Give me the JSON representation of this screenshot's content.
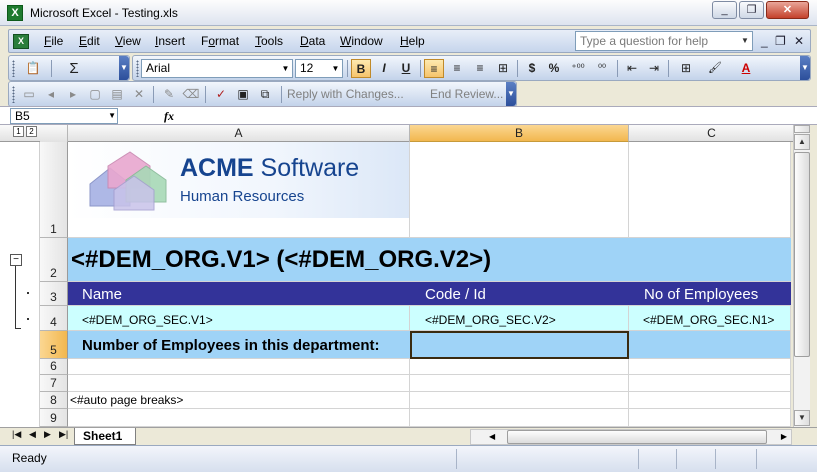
{
  "window": {
    "title": "Microsoft Excel - Testing.xls",
    "app_icon": "X",
    "minimize": "_",
    "restore": "❐",
    "close": "✕"
  },
  "menu": {
    "doc_icon": "X",
    "items": [
      {
        "u": "F",
        "rest": "ile"
      },
      {
        "u": "E",
        "rest": "dit"
      },
      {
        "u": "V",
        "rest": "iew"
      },
      {
        "u": "I",
        "rest": "nsert"
      },
      {
        "pre": "F",
        "u": "o",
        "rest": "rmat"
      },
      {
        "u": "T",
        "rest": "ools"
      },
      {
        "u": "D",
        "rest": "ata"
      },
      {
        "u": "W",
        "rest": "indow"
      },
      {
        "u": "H",
        "rest": "elp"
      }
    ],
    "help_placeholder": "Type a question for help",
    "doc_min": "_",
    "doc_restore": "❐",
    "doc_close": "✕"
  },
  "toolbar1": {
    "paste_icon": "📋",
    "autosum": "Σ",
    "font": "Arial",
    "size": "12",
    "bold": "B",
    "italic": "I",
    "underline": "U",
    "align_left": "≡",
    "center": "≡",
    "align_right": "≡",
    "merge": "⊞",
    "currency": "$",
    "percent": "%",
    "inc_dec": "⁺⁰⁰",
    "dec_dec": "⁰⁰",
    "outdent": "⇤",
    "indent": "⇥",
    "borders": "⊞",
    "fill": "🖌",
    "font_color": "A"
  },
  "toolbar2": {
    "reply": "Reply with Changes...",
    "end_review": "End Review..."
  },
  "formula_bar": {
    "name_box": "B5",
    "fx": "fx",
    "formula": ""
  },
  "columns": [
    "A",
    "B",
    "C"
  ],
  "level_buttons": [
    "1",
    "2"
  ],
  "rows": [
    "1",
    "2",
    "3",
    "4",
    "5",
    "6",
    "7",
    "8",
    "9"
  ],
  "outline_collapse": "−",
  "logo": {
    "name": "ACME",
    "name_rest": " Software",
    "subtitle": "Human Resources"
  },
  "cells": {
    "a2": "<#DEM_ORG.V1> (<#DEM_ORG.V2>)",
    "a3": "Name",
    "b3": "Code / Id",
    "c3": "No of Employees",
    "a4": "<#DEM_ORG_SEC.V1>",
    "b4": "<#DEM_ORG_SEC.V2>",
    "c4": "<#DEM_ORG_SEC.N1>",
    "a5": "Number of Employees in this department:",
    "a8": "<#auto page breaks>"
  },
  "colors": {
    "band_blue": "#9fd3f7",
    "header_navy": "#333399",
    "row_cyan": "#ccffff",
    "logo_blue": "#16448f"
  },
  "sheet_tab": "Sheet1",
  "status": "Ready"
}
